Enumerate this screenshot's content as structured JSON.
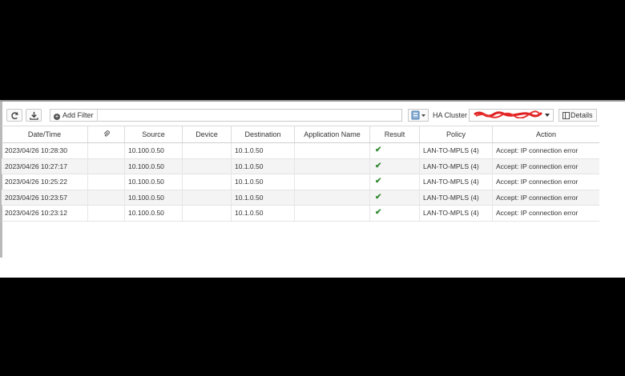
{
  "toolbar": {
    "refresh_icon": "refresh-icon",
    "download_icon": "download-icon",
    "add_filter_label": "Add Filter",
    "ha_cluster_label": "HA Cluster",
    "details_label": "Details"
  },
  "table": {
    "columns": [
      "Date/Time",
      "",
      "Source",
      "Device",
      "Destination",
      "Application Name",
      "Result",
      "Policy",
      "Action"
    ],
    "rows": [
      {
        "datetime": "2023/04/26 10:28:30",
        "source": "10.100.0.50",
        "device": "",
        "destination": "10.1.0.50",
        "app": "",
        "policy": "LAN-TO-MPLS (4)",
        "action": "Accept: IP connection error"
      },
      {
        "datetime": "2023/04/26 10:27:17",
        "source": "10.100.0.50",
        "device": "",
        "destination": "10.1.0.50",
        "app": "",
        "policy": "LAN-TO-MPLS (4)",
        "action": "Accept: IP connection error"
      },
      {
        "datetime": "2023/04/26 10:25:22",
        "source": "10.100.0.50",
        "device": "",
        "destination": "10.1.0.50",
        "app": "",
        "policy": "LAN-TO-MPLS (4)",
        "action": "Accept: IP connection error"
      },
      {
        "datetime": "2023/04/26 10:23:57",
        "source": "10.100.0.50",
        "device": "",
        "destination": "10.1.0.50",
        "app": "",
        "policy": "LAN-TO-MPLS (4)",
        "action": "Accept: IP connection error"
      },
      {
        "datetime": "2023/04/26 10:23:12",
        "source": "10.100.0.50",
        "device": "",
        "destination": "10.1.0.50",
        "app": "",
        "policy": "LAN-TO-MPLS (4)",
        "action": "Accept: IP connection error"
      }
    ]
  },
  "colors": {
    "check": "#2f8a2f",
    "redaction": "#e02020"
  }
}
